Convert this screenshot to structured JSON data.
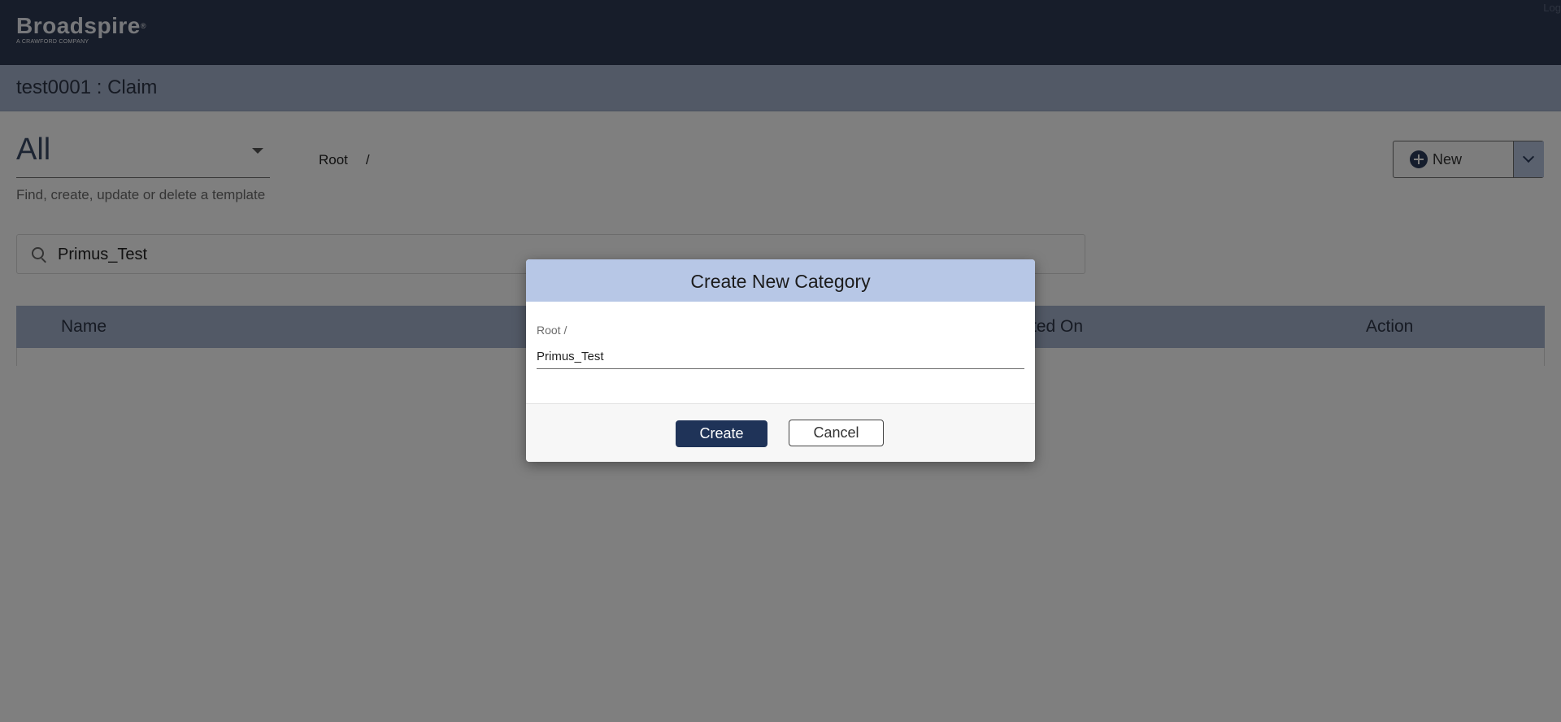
{
  "header": {
    "logo_text": "Broadspire",
    "logo_subtext": "A CRAWFORD COMPANY",
    "logout_label": "Log"
  },
  "claim_bar": {
    "title": "test0001 :  Claim"
  },
  "filter": {
    "selected": "All",
    "subtitle": "Find, create, update or delete a template"
  },
  "breadcrumb": {
    "root": "Root",
    "separator": "/"
  },
  "new_button": {
    "label": "New"
  },
  "search": {
    "value": "Primus_Test"
  },
  "table": {
    "columns": [
      "Name",
      "ted On",
      "Action"
    ]
  },
  "modal": {
    "title": "Create New Category",
    "field_label": "Root /",
    "field_value": "Primus_Test",
    "create_label": "Create",
    "cancel_label": "Cancel"
  },
  "colors": {
    "topbar": "#2f3a55",
    "claim_bar": "#a4b3cc",
    "modal_header": "#b7c7e6",
    "primary_button": "#1f3358"
  }
}
